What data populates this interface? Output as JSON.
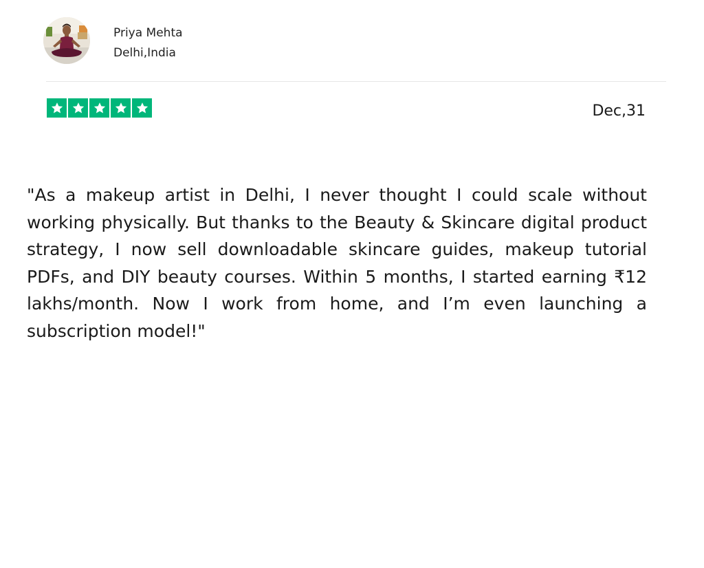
{
  "reviewer": {
    "name": "Priya Mehta",
    "location": "Delhi,India",
    "avatar": "profile-photo-woman-yoga-pose"
  },
  "rating": {
    "stars": 5,
    "max_stars": 5,
    "color": "#00b67a",
    "icon": "star-icon"
  },
  "review": {
    "date": "Dec,31",
    "text": "\"As a makeup artist in Delhi, I never thought I could scale without working physically. But thanks to the Beauty & Skincare digital product strategy, I now sell downloadable skincare guides, makeup tutorial PDFs, and DIY beauty courses. Within 5 months, I started earning ₹12 lakhs/month. Now I work from home, and I’m even launching a subscription model!\""
  }
}
